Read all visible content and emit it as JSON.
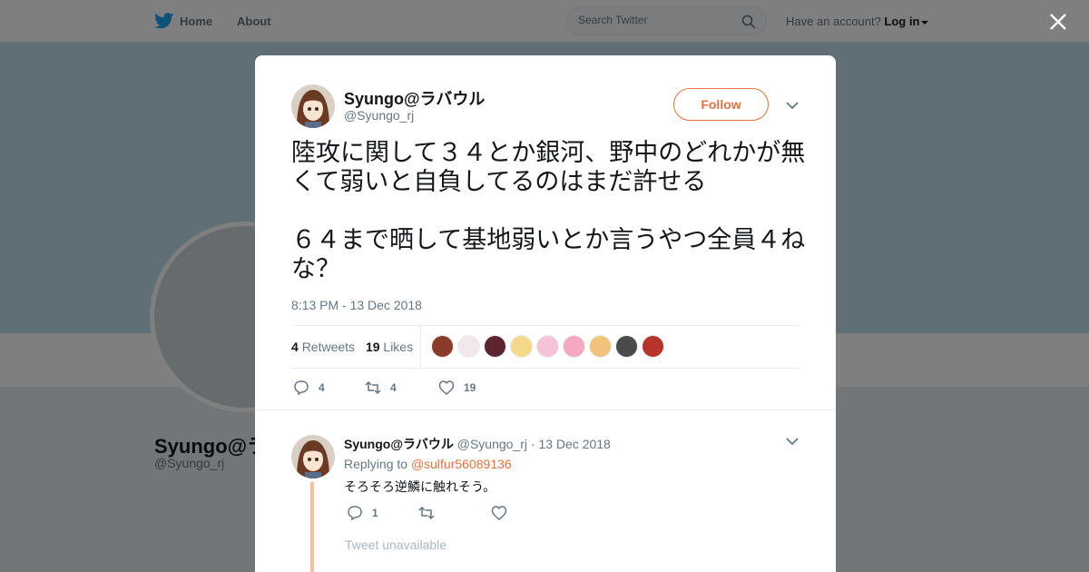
{
  "nav": {
    "home": "Home",
    "about": "About"
  },
  "search": {
    "placeholder": "Search Twitter"
  },
  "account": {
    "prompt": "Have an account?",
    "login": "Log in"
  },
  "background_profile": {
    "name": "Syungo@ラバウル",
    "handle": "@Syungo_rj"
  },
  "tweet": {
    "author_name": "Syungo@ラバウル",
    "author_handle": "@Syungo_rj",
    "follow_label": "Follow",
    "text": "陸攻に関して３４とか銀河、野中のどれかが無くて弱いと自負してるのはまだ許せる\n\n６４まで晒して基地弱いとか言うやつ全員４ねな？",
    "timestamp": "8:13 PM - 13 Dec 2018",
    "retweets_count": "4",
    "retweets_label": "Retweets",
    "likes_count": "19",
    "likes_label": "Likes",
    "actions": {
      "replies": "4",
      "retweets": "4",
      "likes": "19"
    }
  },
  "reply": {
    "author_name": "Syungo@ラバウル",
    "author_handle": "@Syungo_rj",
    "date": "· 13 Dec 2018",
    "replying_prefix": "Replying to",
    "replying_to": "@sulfur56089136",
    "text": "そろそろ逆鱗に触れそう。",
    "actions": {
      "replies": "1",
      "retweets": "",
      "likes": ""
    }
  },
  "unavailable_text": "Tweet unavailable",
  "colors": {
    "accent": "#e0733f",
    "thread_line": "#f8c09f",
    "twitter_blue": "#1da1f2"
  },
  "icons": [
    "twitter-bird-icon",
    "search-icon",
    "close-icon",
    "chevron-down-icon",
    "reply-icon",
    "retweet-icon",
    "heart-icon"
  ]
}
